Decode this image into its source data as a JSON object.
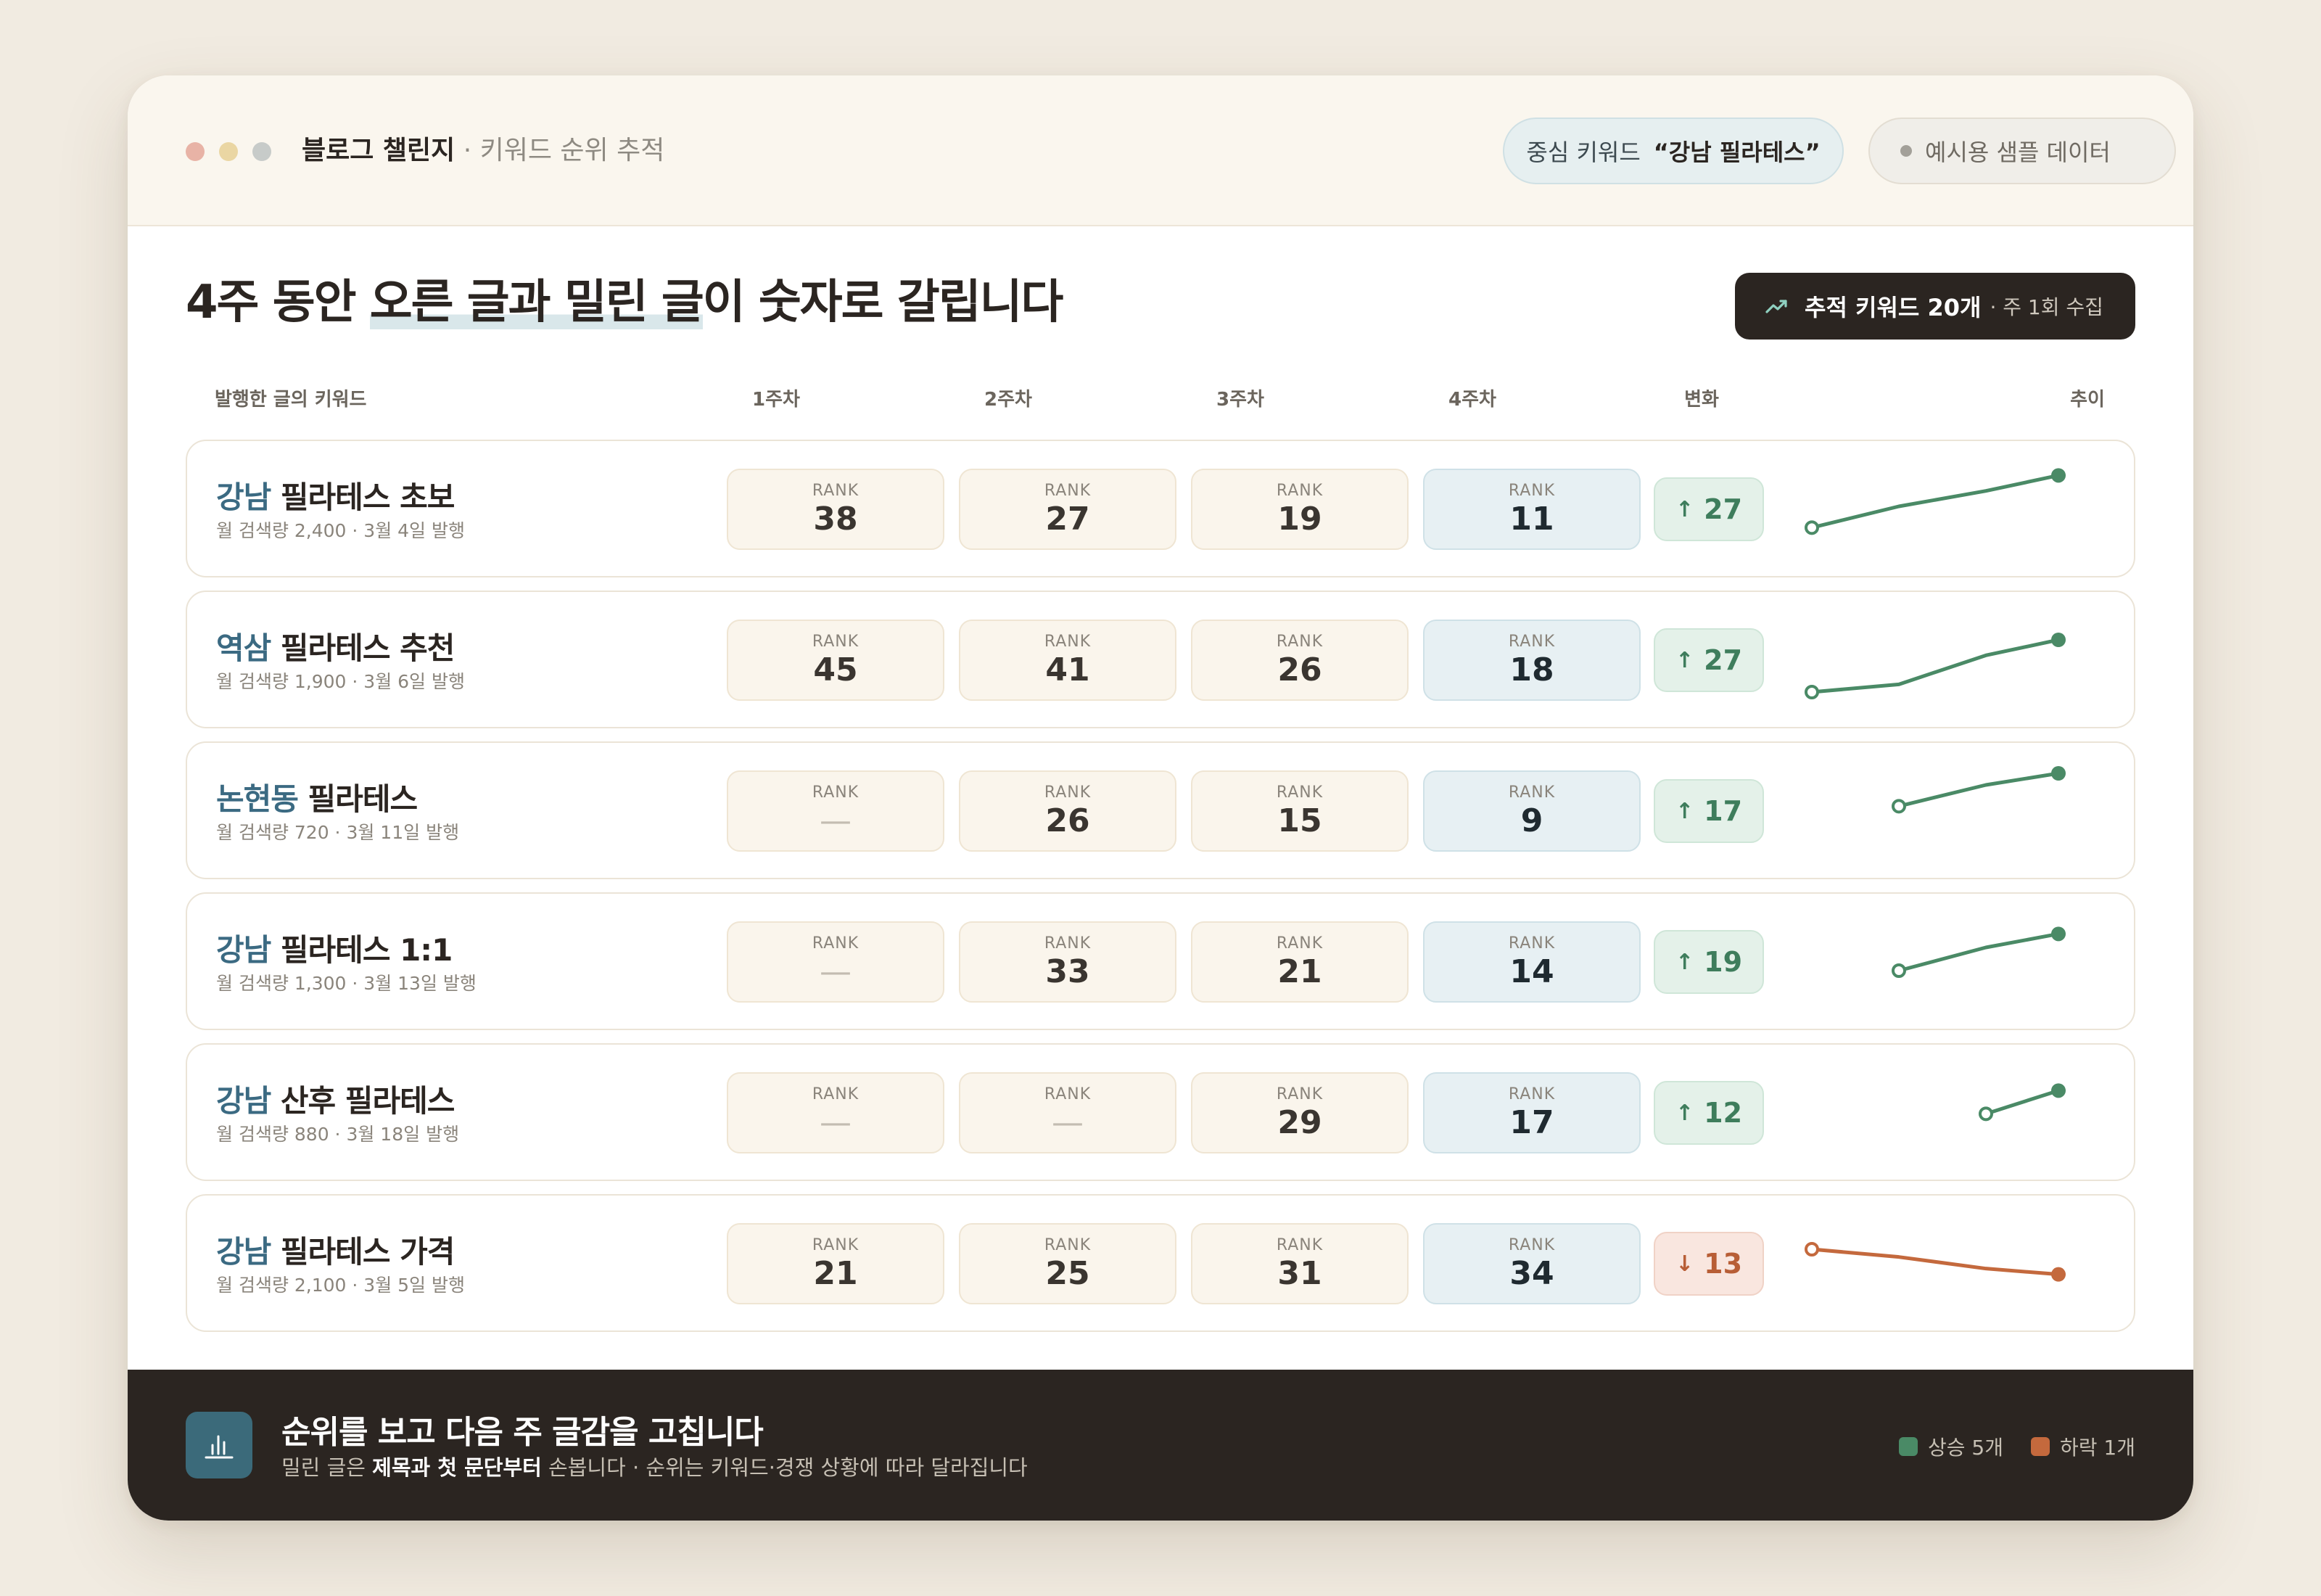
{
  "window": {
    "title_strong": "블로그 챌린지",
    "title_muted": " · 키워드 순위 추적",
    "dot_colors": [
      "#e8b3a6",
      "#ead6a3",
      "#c7cbc9"
    ]
  },
  "header": {
    "keyword_label": "중심 키워드",
    "keyword_value": "“강남 필라테스”",
    "sample_label": "예시용 샘플 데이터"
  },
  "headline": {
    "pre": "4주 동안 ",
    "highlight": "오른 글과 밀린 글",
    "post": "이 숫자로 갈립니다"
  },
  "track": {
    "label": "추적 키워드 20개",
    "sub": "· 주 1회 수집",
    "icon": "trend-up-icon"
  },
  "columns": {
    "keyword": "발행한 글의 키워드",
    "w1": "1주차",
    "w2": "2주차",
    "w3": "3주차",
    "w4": "4주차",
    "change": "변화",
    "trend": "추이"
  },
  "rank_label": "RANK",
  "rows": [
    {
      "loc": "강남",
      "rest": " 필라테스 초보",
      "meta": "월 검색량 2,400 · 3월 4일 발행",
      "ranks": [
        "38",
        "27",
        "19",
        "11"
      ],
      "change": "27",
      "direction": "up"
    },
    {
      "loc": "역삼",
      "rest": " 필라테스 추천",
      "meta": "월 검색량 1,900 · 3월 6일 발행",
      "ranks": [
        "45",
        "41",
        "26",
        "18"
      ],
      "change": "27",
      "direction": "up"
    },
    {
      "loc": "논현동",
      "rest": " 필라테스",
      "meta": "월 검색량 720 · 3월 11일 발행",
      "ranks": [
        "—",
        "26",
        "15",
        "9"
      ],
      "change": "17",
      "direction": "up"
    },
    {
      "loc": "강남",
      "rest": " 필라테스 1:1",
      "meta": "월 검색량 1,300 · 3월 13일 발행",
      "ranks": [
        "—",
        "33",
        "21",
        "14"
      ],
      "change": "19",
      "direction": "up"
    },
    {
      "loc": "강남",
      "rest": " 산후 필라테스",
      "meta": "월 검색량 880 · 3월 18일 발행",
      "ranks": [
        "—",
        "—",
        "29",
        "17"
      ],
      "change": "12",
      "direction": "up"
    },
    {
      "loc": "강남",
      "rest": " 필라테스 가격",
      "meta": "월 검색량 2,100 · 3월 5일 발행",
      "ranks": [
        "21",
        "25",
        "31",
        "34"
      ],
      "change": "13",
      "direction": "down"
    }
  ],
  "colors": {
    "up": "#4a8a66",
    "down": "#c4693d",
    "accent": "#3b6a82"
  },
  "footer": {
    "title": "순위를 보고 다음 주 글감을 고칩니다",
    "sub_pre": "밀린 글은 ",
    "sub_bold": "제목과 첫 문단부터",
    "sub_post": " 손봅니다 · 순위는 키워드·경쟁 상황에 따라 달라집니다",
    "legend_up": "상승 5개",
    "legend_down": "하락 1개",
    "icon": "bar-chart-icon"
  }
}
